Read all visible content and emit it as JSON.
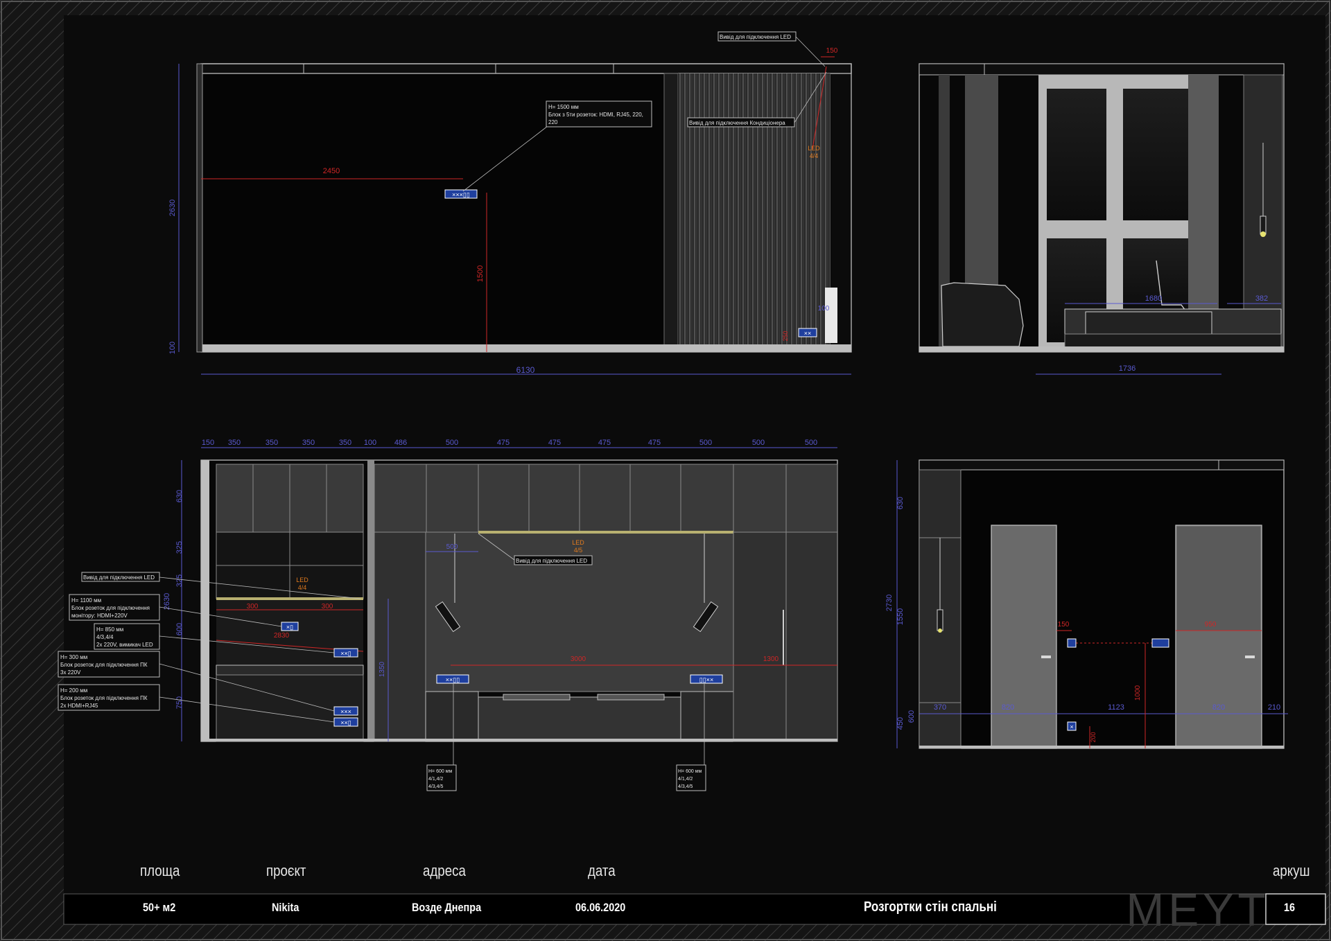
{
  "sheet": {
    "title": "Розгортки стін спальні",
    "sheet_number": "16",
    "brand": "MEYT",
    "headers": {
      "area": "площа",
      "project": "проєкт",
      "address": "адреса",
      "date": "дата",
      "sheet": "аркуш"
    },
    "values": {
      "area": "50+ м2",
      "project": "Nikita",
      "address": "Возде Днепра",
      "date": "06.06.2020"
    }
  },
  "colors": {
    "background": "#151515",
    "hatch": "#3a3a3a",
    "dim_blue": "#5a5ad0",
    "dim_red": "#d02626",
    "led_orange": "#e07a1e",
    "socket_blue": "#1f3f9e",
    "lamp_yellow": "#e6e270"
  },
  "elevations": {
    "top_left": {
      "dims": {
        "width": "6130",
        "height": "2630",
        "plinth": "100",
        "socket_offset": "2450",
        "socket_height": "1500",
        "top_offset": "150",
        "side_100": "100",
        "bottom_250": "250"
      },
      "notes": {
        "socket_block": [
          "H= 1500 мм",
          "Блок з 5ти розеток: HDMI, RJ45, 220,",
          "220"
        ],
        "led_outlet": "Вивід для підключення LED",
        "ac_outlet": "Вивід для підключення Кондиціонера",
        "led_tag": [
          "LED",
          "4/4"
        ]
      }
    },
    "top_right": {
      "dims": {
        "bottom": "1736",
        "desk": "1680",
        "shelf": "382"
      }
    },
    "bottom_left": {
      "dims": {
        "top_row": [
          "150",
          "350",
          "350",
          "350",
          "350",
          "100",
          "486",
          "500",
          "475",
          "475",
          "475",
          "475",
          "500",
          "500",
          "500"
        ],
        "left_col": [
          "630",
          "325",
          "325",
          "2630",
          "600",
          "750"
        ],
        "inner": [
          "500",
          "300",
          "300",
          "2830",
          "1350",
          "3000",
          "1300"
        ]
      },
      "notes": {
        "led_outlet_left": "Вивід для підключення LED",
        "led_outlet_center": "Вивід для підключення LED",
        "monitor_block": [
          "H= 1100 мм",
          "Блок розеток для підключення",
          "монітору: HDMI+220V"
        ],
        "switch_block": [
          "H= 850 мм",
          "4/3,4/4",
          "2x 220V, вимикач LED"
        ],
        "pc_block_300": [
          "H= 300 мм",
          "Блок розеток для підключення ПК",
          "3x 220V"
        ],
        "pc_block_200": [
          "H= 200 мм",
          "Блок розеток для підключення ПК",
          "2x HDMI+RJ45"
        ],
        "bed_left": [
          "H= 600 мм",
          "4/1,4/2",
          "4/3,4/5"
        ],
        "bed_right": [
          "H= 600 мм",
          "4/1,4/2",
          "4/3,4/5"
        ],
        "led_tag_left": [
          "LED",
          "4/4"
        ],
        "led_tag_center": [
          "LED",
          "4/5"
        ]
      }
    },
    "bottom_right": {
      "dims": {
        "left_col": [
          "630",
          "2730",
          "1550",
          "600",
          "450"
        ],
        "bottom_row": [
          "370",
          "820",
          "1123",
          "820",
          "210"
        ],
        "door_offset": "150",
        "door_right": "950",
        "socket_height": "1000",
        "low_socket": "200"
      }
    }
  }
}
